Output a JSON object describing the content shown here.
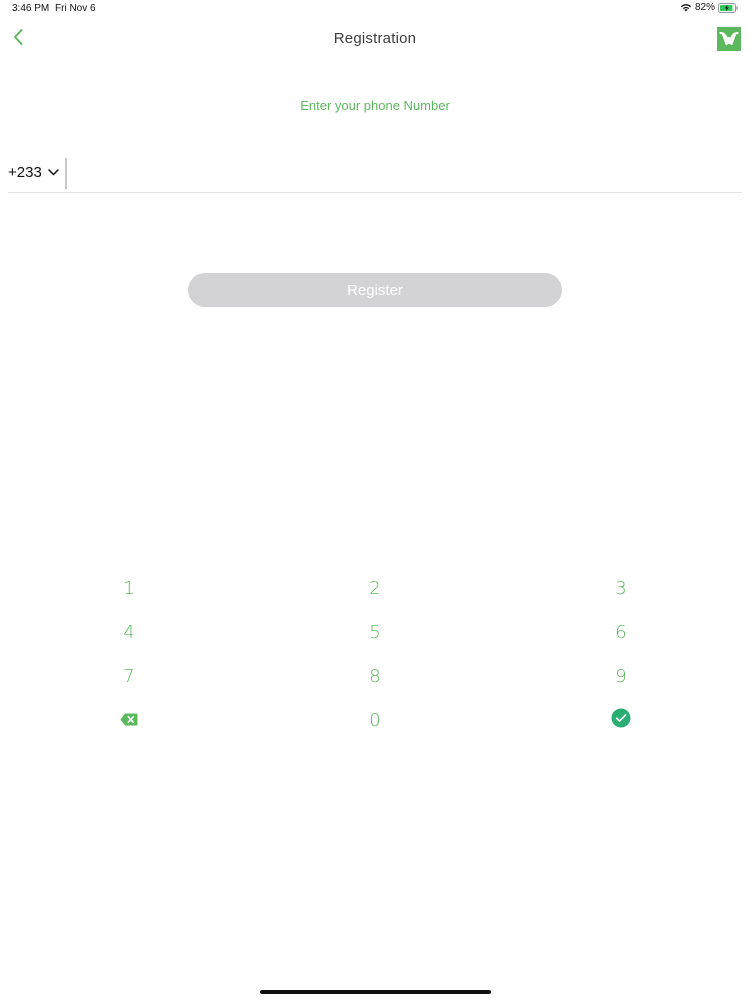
{
  "status_bar": {
    "time": "3:46 PM",
    "date": "Fri Nov 6",
    "battery": "82%",
    "icons": [
      "wifi-icon",
      "battery-charging-icon"
    ]
  },
  "nav": {
    "title": "Registration",
    "back_icon": "chevron-left-icon",
    "logo_icon": "app-logo-icon"
  },
  "form": {
    "prompt": "Enter your phone Number",
    "country_code": "+233",
    "dropdown_icon": "chevron-down-icon",
    "phone_value": "",
    "register_label": "Register"
  },
  "keypad": {
    "keys": [
      "1",
      "2",
      "3",
      "4",
      "5",
      "6",
      "7",
      "8",
      "9",
      "",
      "0",
      ""
    ],
    "backspace_icon": "backspace-icon",
    "confirm_icon": "checkmark-circle-icon"
  },
  "colors": {
    "accent": "#5cb85c",
    "button_disabled": "#d3d3d6",
    "title_text": "#3d3d3d",
    "confirm_icon": "#2bae74"
  }
}
